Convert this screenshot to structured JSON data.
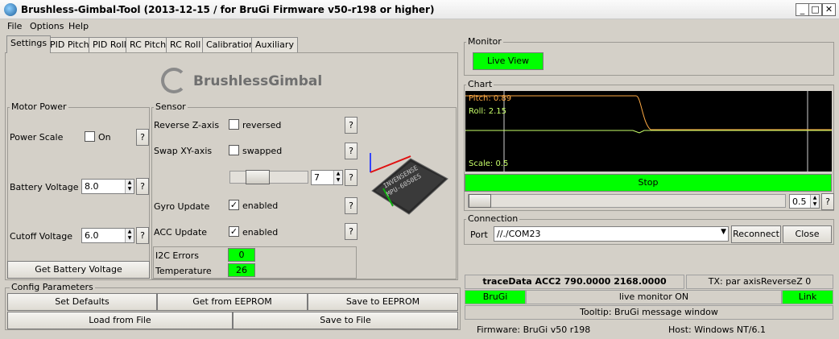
{
  "window": {
    "title": "Brushless-Gimbal-Tool (2013-12-15 / for BruGi Firmware v50-r198 or higher)",
    "min": "_",
    "max": "□",
    "close": "✕"
  },
  "menu": [
    "File",
    "Options",
    "Help"
  ],
  "tabs": [
    "Settings",
    "PID Pitch",
    "PID Roll",
    "RC Pitch",
    "RC Roll",
    "Calibration",
    "Auxiliary"
  ],
  "logo": "BrushlessGimbal",
  "motor": {
    "title": "Motor Power",
    "power_scale_label": "Power Scale",
    "power_scale_check": "On",
    "battery_label": "Battery Voltage",
    "battery_value": "8.0",
    "cutoff_label": "Cutoff Voltage",
    "cutoff_value": "6.0",
    "get_battery": "Get Battery Voltage"
  },
  "sensor": {
    "title": "Sensor",
    "reverse_label": "Reverse Z-axis",
    "reverse_check": "reversed",
    "swap_label": "Swap XY-axis",
    "swap_check": "swapped",
    "slider_value": "7",
    "gyro_label": "Gyro Update",
    "gyro_check": "enabled",
    "acc_label": "ACC Update",
    "acc_check": "enabled",
    "i2c_label": "I2C Errors",
    "i2c_value": "0",
    "temp_label": "Temperature",
    "temp_value": "26",
    "chip_text": "INVENSENSE MPU-6050ES 1X514-M1 1138 C",
    "slider_level": 0.3
  },
  "help": "?",
  "config": {
    "title": "Config Parameters",
    "set_defaults": "Set Defaults",
    "get_eeprom": "Get from EEPROM",
    "save_eeprom": "Save to EEPROM",
    "load_file": "Load from File",
    "save_file": "Save to File"
  },
  "monitor": {
    "title": "Monitor",
    "live_view": "Live View"
  },
  "chart": {
    "title": "Chart",
    "pitch": "Pitch: 0.89",
    "roll": "Roll: 2.15",
    "scale": "Scale: 0.5",
    "stop": "Stop",
    "scale_value": "0.5",
    "scale_level": 0.05
  },
  "connection": {
    "title": "Connection",
    "port_label": "Port",
    "port_value": "//./COM23",
    "reconnect": "Reconnect",
    "close": "Close"
  },
  "status": {
    "trace": "traceData ACC2 790.0000 2168.0000",
    "tx": "TX: par axisReverseZ 0",
    "brugi": "BruGi",
    "live_monitor": "live monitor ON",
    "link": "Link",
    "tooltip": "Tooltip: BruGi message window",
    "firmware": "Firmware: BruGi v50 r198",
    "host": "Host: Windows NT/6.1"
  },
  "colors": {
    "green": "#00ff00",
    "pitch": "#ffaa44",
    "roll": "#c8ff6a",
    "chart_bg": "#000000"
  }
}
